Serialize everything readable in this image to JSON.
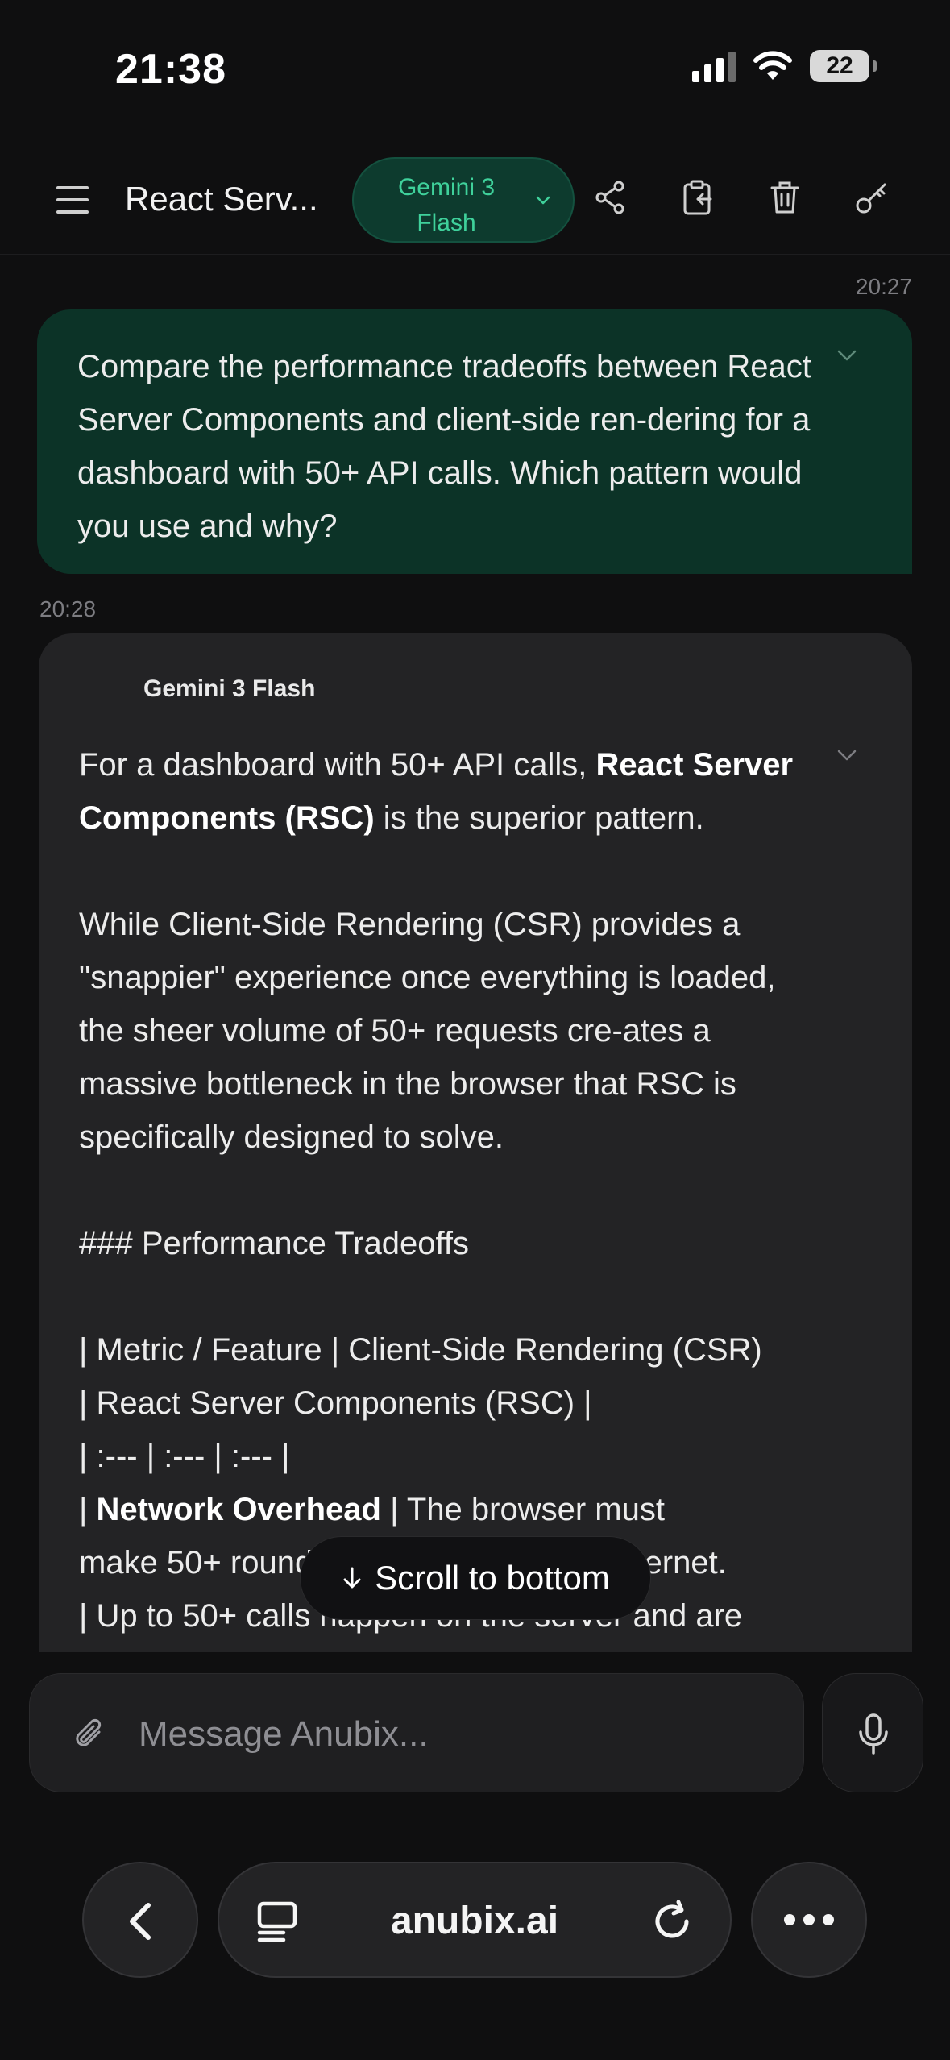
{
  "status_bar": {
    "time": "21:38",
    "battery": "22"
  },
  "header": {
    "menu_icon": "hamburger-icon",
    "title": "React Serv...",
    "model_line1": "Gemini 3",
    "model_line2": "Flash",
    "icons": [
      "share-icon",
      "clipboard-icon",
      "trash-icon",
      "key-icon"
    ]
  },
  "colors": {
    "accent_green": "#3fd19b",
    "user_bubble": "#0c3327",
    "ai_bubble": "#232325",
    "background": "#0f0f10"
  },
  "messages": {
    "user": {
      "timestamp": "20:27",
      "text": "Compare the performance tradeoffs between React Server Components and client-side ren-dering for a dashboard with 50+ API calls. Which pattern would you use and why?"
    },
    "ai": {
      "timestamp": "20:28",
      "model": "Gemini 3 Flash",
      "p1_a": "For a dashboard with 50+ API calls, ",
      "p1_bold": "React Server Components (RSC)",
      "p1_b": " is the superior pattern.",
      "p2": "While Client-Side Rendering (CSR) provides a \"snappier\" experience once everything is loaded, the sheer volume of 50+ requests cre-ates a massive bottleneck in the browser that RSC is specifically designed to solve.",
      "p3": "### Performance Tradeoffs",
      "p4_l1": "| Metric / Feature | Client-Side Rendering (CSR)",
      "p4_l2": "| React Server Components (RSC) |",
      "p4_l3": "| :--- | :--- | :--- |",
      "p4_l4_a": "| ",
      "p4_l4_bold": "Network Overhead",
      "p4_l4_b": " | The browser must",
      "p4_l5": "make 50+ round trips over the public internet.",
      "p4_l6": "| Up to 50+ calls happen on the server and are"
    }
  },
  "scroll_button": {
    "label": "Scroll to bottom",
    "icon": "arrow-down-icon"
  },
  "composer": {
    "placeholder": "Message Anubix...",
    "attach_icon": "paperclip-icon",
    "mic_icon": "microphone-icon"
  },
  "browser": {
    "url": "anubix.ai",
    "back_icon": "chevron-left-icon",
    "tabs_icon": "tabs-icon",
    "reload_icon": "reload-icon",
    "more_icon": "more-icon"
  }
}
